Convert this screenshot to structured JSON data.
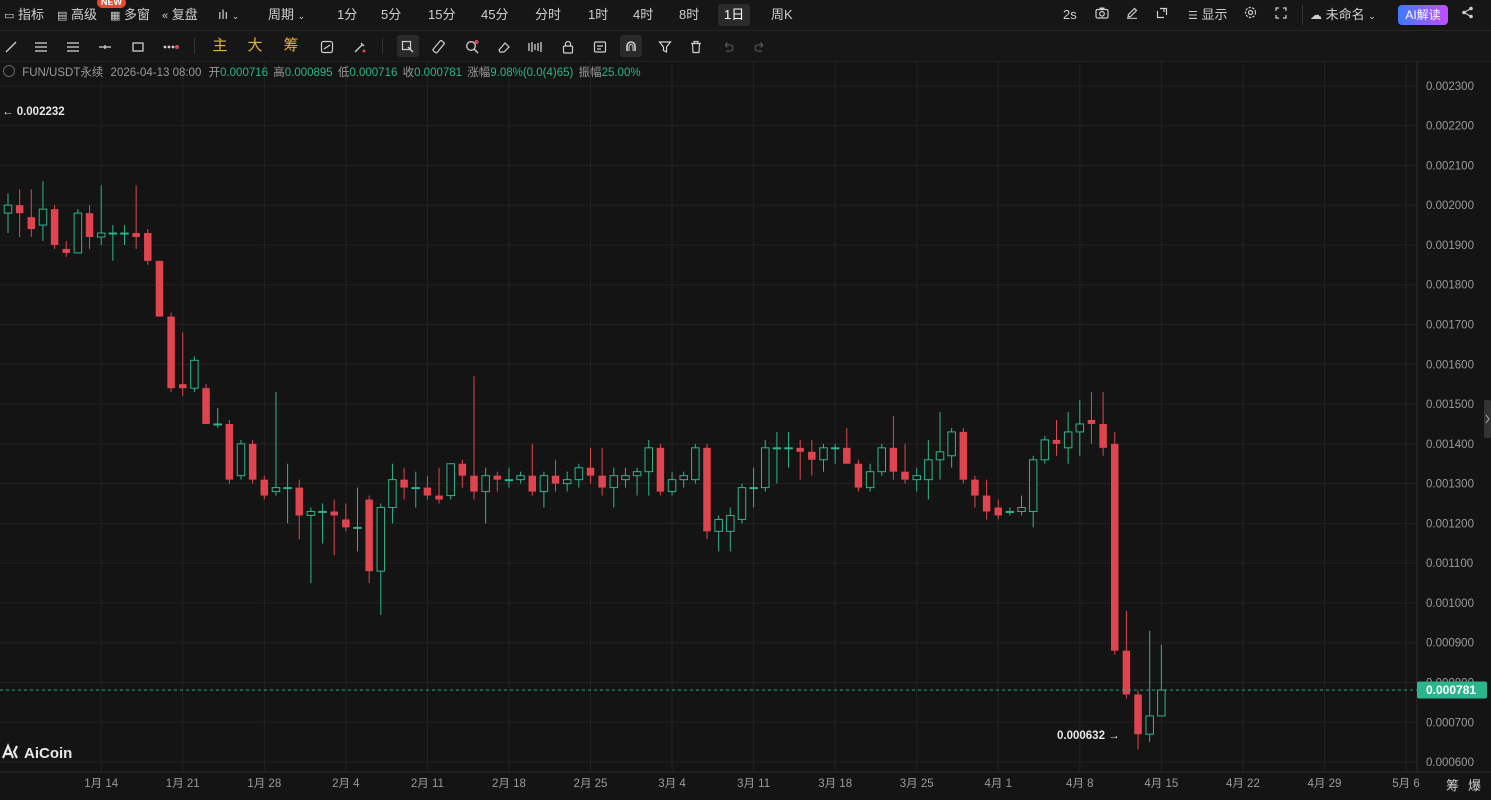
{
  "toolbar": {
    "indicators": "指标",
    "advanced": "高级",
    "new_badge": "NEW",
    "multi_window": "多窗",
    "replay": "复盘",
    "period": "周期",
    "intervals": [
      "1分",
      "5分",
      "15分",
      "45分",
      "分时",
      "1时",
      "4时",
      "8时",
      "1日",
      "周K"
    ],
    "active_interval": "1日",
    "refresh": "2s",
    "display": "显示",
    "layout_name": "未命名",
    "ai_button": "AI解读"
  },
  "drawing_tools": {
    "main_label": "主",
    "big_label": "大",
    "chip_label": "筹"
  },
  "info": {
    "symbol": "FUN/USDT永续",
    "datetime": "2026-04-13 08:00",
    "open_label": "开",
    "open": "0.000716",
    "high_label": "高",
    "high": "0.000895",
    "low_label": "低",
    "low": "0.000716",
    "close_label": "收",
    "close": "0.000781",
    "change_label": "涨幅",
    "change": "9.08%(0.0(4)65)",
    "amplitude_label": "振幅",
    "amplitude": "25.00%"
  },
  "annotations": {
    "high_marker": "← 0.002232",
    "low_marker": "0.000632 →",
    "current_price": "0.000781"
  },
  "logo": "AiCoin",
  "bottom_right": [
    "筹",
    "爆"
  ],
  "colors": {
    "up": "#2bb58c",
    "down": "#e0444f",
    "bg": "#141414",
    "grid": "#222222"
  },
  "chart_data": {
    "type": "candlestick",
    "y_ticks": [
      "0.002300",
      "0.002200",
      "0.002100",
      "0.002000",
      "0.001900",
      "0.001800",
      "0.001700",
      "0.001600",
      "0.001500",
      "0.001400",
      "0.001300",
      "0.001200",
      "0.001100",
      "0.001000",
      "0.000900",
      "0.000800",
      "0.000700",
      "0.000600"
    ],
    "ylim": [
      0.000575,
      0.00236
    ],
    "x_ticks": [
      "1月 14",
      "1月 21",
      "1月 28",
      "2月 4",
      "2月 11",
      "2月 18",
      "2月 25",
      "3月 4",
      "3月 11",
      "3月 18",
      "3月 25",
      "4月 1",
      "4月 8",
      "4月 15",
      "4月 22",
      "4月 29",
      "5月 6"
    ],
    "candles": [
      [
        "01-06",
        0.00198,
        0.002,
        0.00203,
        0.00193
      ],
      [
        "01-07",
        0.002,
        0.00198,
        0.00204,
        0.00192
      ],
      [
        "01-08",
        0.00197,
        0.00194,
        0.00204,
        0.00192
      ],
      [
        "01-09",
        0.00195,
        0.00199,
        0.00206,
        0.00191
      ],
      [
        "01-10",
        0.00199,
        0.0019,
        0.002,
        0.00189
      ],
      [
        "01-11",
        0.00189,
        0.00188,
        0.00191,
        0.00187
      ],
      [
        "01-12",
        0.00188,
        0.00198,
        0.00199,
        0.00188
      ],
      [
        "01-13",
        0.00198,
        0.00192,
        0.002,
        0.00189
      ],
      [
        "01-14",
        0.00192,
        0.00193,
        0.00205,
        0.0019
      ],
      [
        "01-15",
        0.00193,
        0.00193,
        0.00195,
        0.00186
      ],
      [
        "01-16",
        0.00193,
        0.00193,
        0.00195,
        0.0019
      ],
      [
        "01-17",
        0.00193,
        0.00192,
        0.00205,
        0.00189
      ],
      [
        "01-18",
        0.00193,
        0.00186,
        0.00194,
        0.00185
      ],
      [
        "01-19",
        0.00186,
        0.00172,
        0.00186,
        0.00172
      ],
      [
        "01-20",
        0.00172,
        0.00154,
        0.00173,
        0.00153
      ],
      [
        "01-21",
        0.00155,
        0.00154,
        0.00168,
        0.00152
      ],
      [
        "01-22",
        0.00154,
        0.00161,
        0.00162,
        0.00153
      ],
      [
        "01-23",
        0.00154,
        0.00145,
        0.00155,
        0.00145
      ],
      [
        "01-24",
        0.00145,
        0.00145,
        0.00149,
        0.00144
      ],
      [
        "01-25",
        0.00145,
        0.00131,
        0.00146,
        0.0013
      ],
      [
        "01-26",
        0.00132,
        0.0014,
        0.00141,
        0.00131
      ],
      [
        "01-27",
        0.0014,
        0.00131,
        0.00141,
        0.0013
      ],
      [
        "01-28",
        0.00131,
        0.00127,
        0.00132,
        0.00126
      ],
      [
        "01-29",
        0.00128,
        0.00129,
        0.00153,
        0.00127
      ],
      [
        "01-30",
        0.00129,
        0.00129,
        0.00135,
        0.0012
      ],
      [
        "01-31",
        0.00129,
        0.00122,
        0.00131,
        0.00116
      ],
      [
        "02-01",
        0.00122,
        0.00123,
        0.00124,
        0.00105
      ],
      [
        "02-02",
        0.00123,
        0.00123,
        0.00125,
        0.00115
      ],
      [
        "02-03",
        0.00123,
        0.00122,
        0.00126,
        0.00112
      ],
      [
        "02-04",
        0.00121,
        0.00119,
        0.00125,
        0.00118
      ],
      [
        "02-05",
        0.00119,
        0.00119,
        0.00129,
        0.00113
      ],
      [
        "02-06",
        0.00126,
        0.00108,
        0.00127,
        0.00105
      ],
      [
        "02-07",
        0.00108,
        0.00124,
        0.00125,
        0.00097
      ],
      [
        "02-08",
        0.00124,
        0.00131,
        0.00135,
        0.0012
      ],
      [
        "02-09",
        0.00131,
        0.00129,
        0.00134,
        0.00126
      ],
      [
        "02-10",
        0.00129,
        0.00129,
        0.00133,
        0.00124
      ],
      [
        "02-11",
        0.00129,
        0.00127,
        0.00132,
        0.00126
      ],
      [
        "02-12",
        0.00127,
        0.00126,
        0.00134,
        0.00125
      ],
      [
        "02-13",
        0.00127,
        0.00135,
        0.00135,
        0.00126
      ],
      [
        "02-14",
        0.00135,
        0.00132,
        0.00136,
        0.00129
      ],
      [
        "02-15",
        0.00132,
        0.00128,
        0.00157,
        0.00126
      ],
      [
        "02-16",
        0.00128,
        0.00132,
        0.00134,
        0.0012
      ],
      [
        "02-17",
        0.00132,
        0.00131,
        0.00133,
        0.00128
      ],
      [
        "02-18",
        0.00131,
        0.00131,
        0.00134,
        0.00129
      ],
      [
        "02-19",
        0.00131,
        0.00132,
        0.00133,
        0.0013
      ],
      [
        "02-20",
        0.00132,
        0.00128,
        0.0014,
        0.00127
      ],
      [
        "02-21",
        0.00128,
        0.00132,
        0.00133,
        0.00124
      ],
      [
        "02-22",
        0.00132,
        0.0013,
        0.00136,
        0.00128
      ],
      [
        "02-23",
        0.0013,
        0.00131,
        0.00133,
        0.00128
      ],
      [
        "02-24",
        0.00131,
        0.00134,
        0.00135,
        0.00129
      ],
      [
        "02-25",
        0.00134,
        0.00132,
        0.00139,
        0.0013
      ],
      [
        "02-26",
        0.00132,
        0.00129,
        0.00139,
        0.00127
      ],
      [
        "02-27",
        0.00129,
        0.00132,
        0.00134,
        0.00124
      ],
      [
        "02-28",
        0.00131,
        0.00132,
        0.00134,
        0.00129
      ],
      [
        "03-01",
        0.00132,
        0.00133,
        0.00134,
        0.00127
      ],
      [
        "03-02",
        0.00133,
        0.00139,
        0.00141,
        0.00127
      ],
      [
        "03-03",
        0.00139,
        0.00128,
        0.0014,
        0.00127
      ],
      [
        "03-04",
        0.00128,
        0.00131,
        0.00133,
        0.00127
      ],
      [
        "03-05",
        0.00131,
        0.00132,
        0.00133,
        0.00129
      ],
      [
        "03-06",
        0.00131,
        0.00139,
        0.0014,
        0.0013
      ],
      [
        "03-07",
        0.00139,
        0.00118,
        0.0014,
        0.00116
      ],
      [
        "03-08",
        0.00118,
        0.00121,
        0.00122,
        0.00113
      ],
      [
        "03-09",
        0.00118,
        0.00122,
        0.00124,
        0.00113
      ],
      [
        "03-10",
        0.00121,
        0.00129,
        0.0013,
        0.0012
      ],
      [
        "03-11",
        0.00129,
        0.00129,
        0.00134,
        0.00124
      ],
      [
        "03-12",
        0.00129,
        0.00139,
        0.00141,
        0.00128
      ],
      [
        "03-13",
        0.00139,
        0.00139,
        0.00143,
        0.0013
      ],
      [
        "03-14",
        0.00139,
        0.00139,
        0.00143,
        0.00134
      ],
      [
        "03-15",
        0.00139,
        0.00138,
        0.00141,
        0.00131
      ],
      [
        "03-16",
        0.00138,
        0.00136,
        0.00141,
        0.00132
      ],
      [
        "03-17",
        0.00136,
        0.00139,
        0.0014,
        0.00133
      ],
      [
        "03-18",
        0.00139,
        0.00139,
        0.0014,
        0.00135
      ],
      [
        "03-19",
        0.00139,
        0.00135,
        0.00144,
        0.00135
      ],
      [
        "03-20",
        0.00135,
        0.00129,
        0.00136,
        0.00128
      ],
      [
        "03-21",
        0.00129,
        0.00133,
        0.00135,
        0.00128
      ],
      [
        "03-22",
        0.00133,
        0.00139,
        0.0014,
        0.00132
      ],
      [
        "03-23",
        0.00139,
        0.00133,
        0.00147,
        0.00131
      ],
      [
        "03-24",
        0.00133,
        0.00131,
        0.0014,
        0.0013
      ],
      [
        "03-25",
        0.00131,
        0.00132,
        0.00134,
        0.00128
      ],
      [
        "03-26",
        0.00131,
        0.00136,
        0.00141,
        0.00126
      ],
      [
        "03-27",
        0.00136,
        0.00138,
        0.00148,
        0.00131
      ],
      [
        "03-28",
        0.00137,
        0.00143,
        0.00144,
        0.00134
      ],
      [
        "03-29",
        0.00143,
        0.00131,
        0.00144,
        0.0013
      ],
      [
        "03-30",
        0.00131,
        0.00127,
        0.00132,
        0.00124
      ],
      [
        "03-31",
        0.00127,
        0.00123,
        0.00131,
        0.00121
      ],
      [
        "04-01",
        0.00124,
        0.00122,
        0.00126,
        0.00121
      ],
      [
        "04-02",
        0.00123,
        0.00123,
        0.00124,
        0.00122
      ],
      [
        "04-03",
        0.00123,
        0.00124,
        0.00127,
        0.00122
      ],
      [
        "04-04",
        0.00123,
        0.00136,
        0.00137,
        0.00119
      ],
      [
        "04-05",
        0.00136,
        0.00141,
        0.00142,
        0.00135
      ],
      [
        "04-06",
        0.00141,
        0.0014,
        0.00146,
        0.00137
      ],
      [
        "04-07",
        0.00139,
        0.00143,
        0.00148,
        0.00135
      ],
      [
        "04-08",
        0.00143,
        0.00145,
        0.00151,
        0.00137
      ],
      [
        "04-09",
        0.00146,
        0.00145,
        0.00153,
        0.0014
      ],
      [
        "04-10",
        0.00145,
        0.00139,
        0.00153,
        0.00137
      ],
      [
        "04-11",
        0.0014,
        0.00088,
        0.00143,
        0.00087
      ],
      [
        "04-12",
        0.00088,
        0.00077,
        0.00098,
        0.00076
      ],
      [
        "04-13",
        0.00077,
        0.00067,
        0.00078,
        0.000632
      ],
      [
        "04-14",
        0.00067,
        0.000716,
        0.00093,
        0.00065
      ],
      [
        "04-15",
        0.000716,
        0.000781,
        0.000895,
        0.000716
      ]
    ]
  }
}
